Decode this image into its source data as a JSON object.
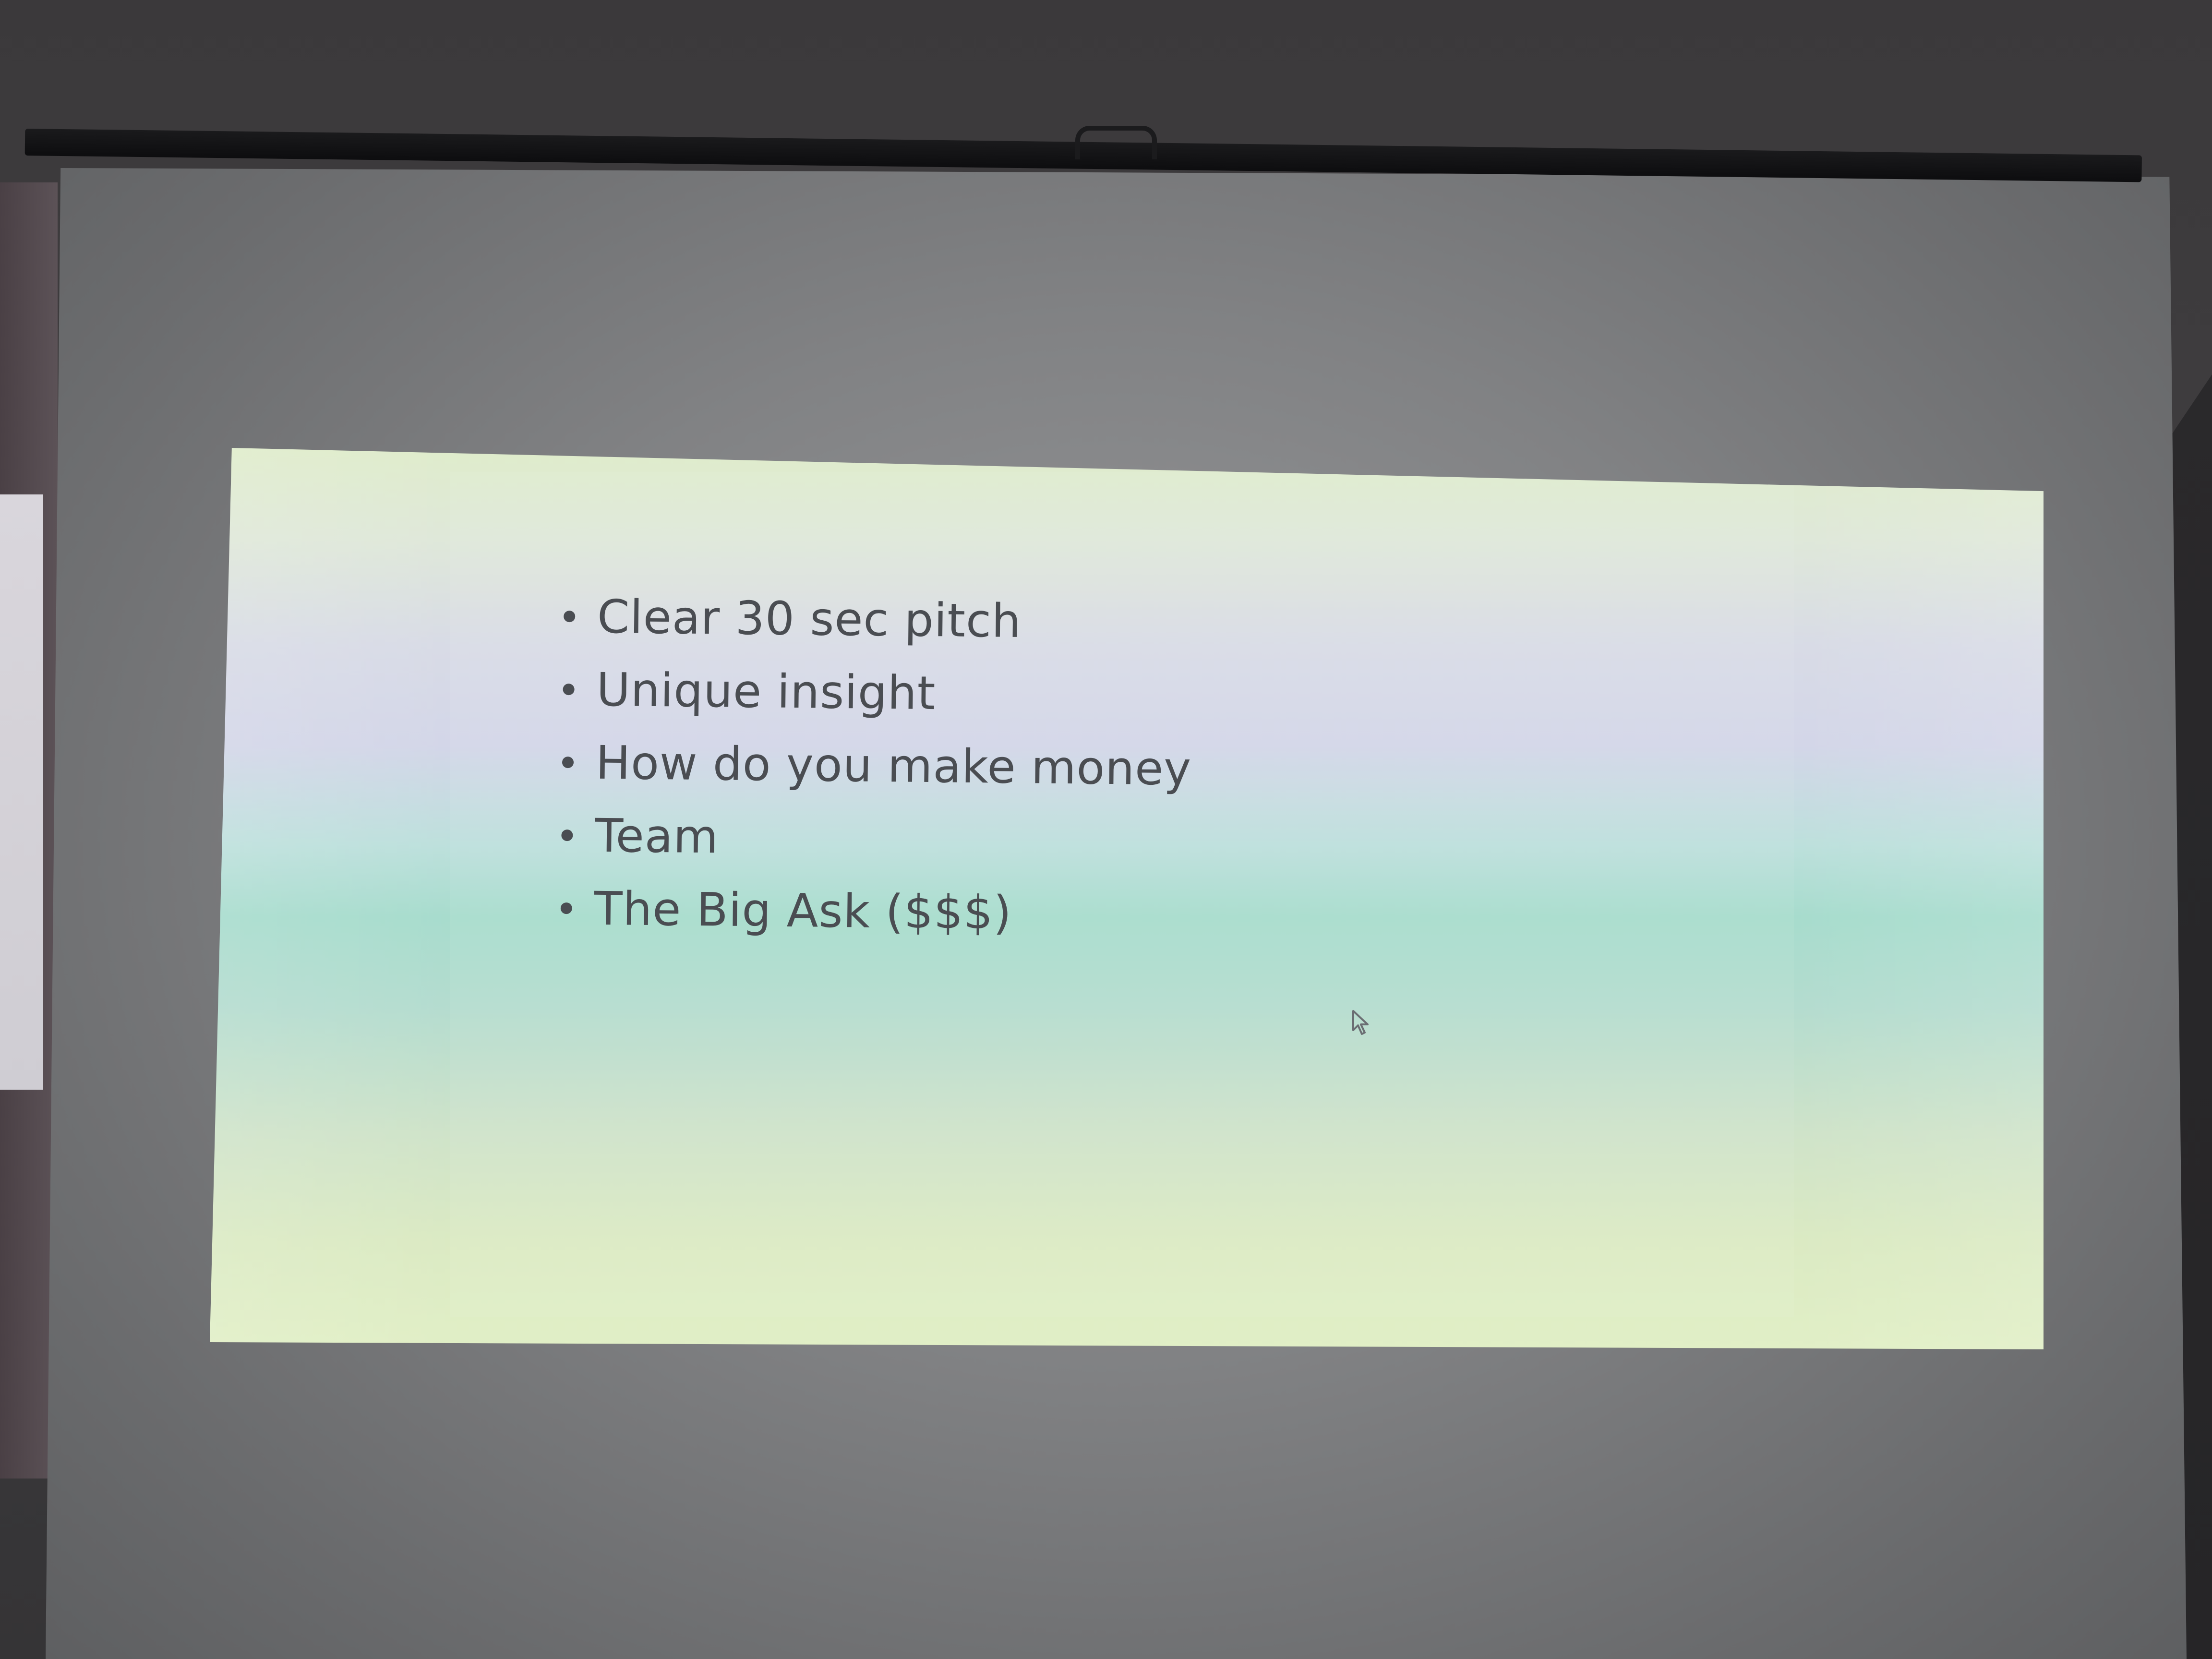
{
  "slide": {
    "bullets": [
      "Clear 30 sec pitch",
      "Unique insight",
      "How do you make money",
      "Team",
      "The Big Ask ($$$)"
    ]
  },
  "icons": {
    "cursor": "mouse-pointer-icon"
  },
  "colors": {
    "text": "#4a4d52",
    "slide_top": "#dfeccb",
    "slide_mid": "#a7dccd",
    "slide_bottom": "#e1efc6",
    "screen": "#8a8b8d",
    "room": "#3c3b3d"
  }
}
